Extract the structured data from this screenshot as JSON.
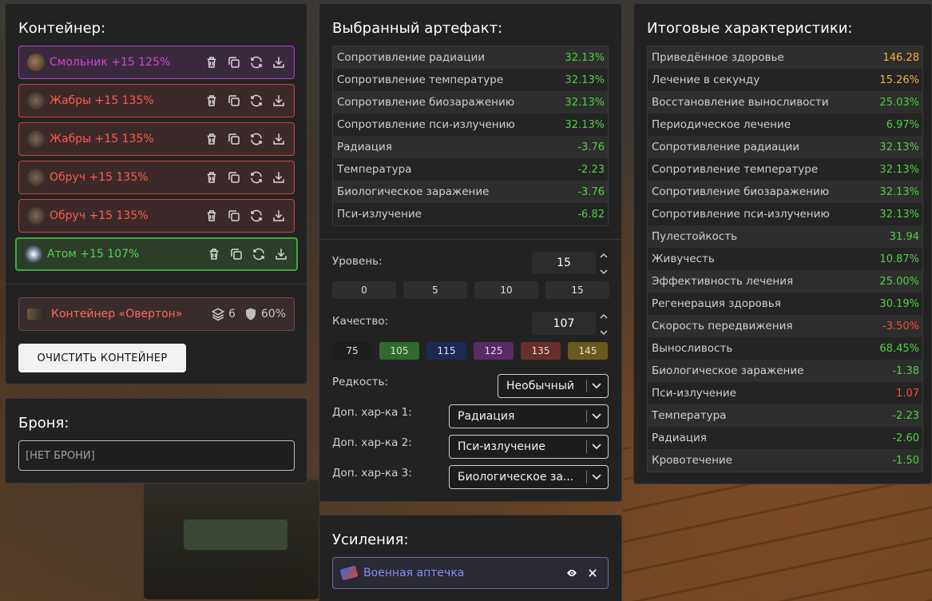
{
  "container": {
    "title": "Контейнер:",
    "items": [
      {
        "label": "Смольник +15 125%",
        "color": "purple",
        "icon": "smolnik-artifact-icon"
      },
      {
        "label": "Жабры +15 135%",
        "color": "red",
        "icon": "gills-artifact-icon"
      },
      {
        "label": "Жабры +15 135%",
        "color": "red",
        "icon": "gills-artifact-icon"
      },
      {
        "label": "Обруч +15 135%",
        "color": "red",
        "icon": "hoop-artifact-icon"
      },
      {
        "label": "Обруч +15 135%",
        "color": "red",
        "icon": "hoop-artifact-icon"
      },
      {
        "label": "Атом +15 107%",
        "color": "green",
        "icon": "atom-artifact-icon"
      }
    ],
    "container_type": {
      "label": "Контейнер «Овертон»",
      "slots": "6",
      "protection": "60%"
    },
    "clear_label": "ОЧИСТИТЬ КОНТЕЙНЕР"
  },
  "armor": {
    "title": "Броня:",
    "value": "[НЕТ БРОНИ]"
  },
  "artifact": {
    "title": "Выбранный артефакт:",
    "stats": [
      {
        "name": "Сопротивление радиации",
        "value": "32.13%",
        "tone": "pos"
      },
      {
        "name": "Сопротивление температуре",
        "value": "32.13%",
        "tone": "pos"
      },
      {
        "name": "Сопротивление биозаражению",
        "value": "32.13%",
        "tone": "pos"
      },
      {
        "name": "Сопротивление пси-излучению",
        "value": "32.13%",
        "tone": "pos"
      },
      {
        "name": "Радиация",
        "value": "-3.76",
        "tone": "pos"
      },
      {
        "name": "Температура",
        "value": "-2.23",
        "tone": "pos"
      },
      {
        "name": "Биологическое заражение",
        "value": "-3.76",
        "tone": "pos"
      },
      {
        "name": "Пси-излучение",
        "value": "-6.82",
        "tone": "pos"
      }
    ],
    "level_label": "Уровень:",
    "level_value": "15",
    "level_presets": [
      "0",
      "5",
      "10",
      "15"
    ],
    "quality_label": "Качество:",
    "quality_value": "107",
    "quality_presets": [
      {
        "label": "75",
        "color": "#1e1e1e"
      },
      {
        "label": "105",
        "color": "#2f6a2c"
      },
      {
        "label": "115",
        "color": "#1e2a55"
      },
      {
        "label": "125",
        "color": "#5a2a66"
      },
      {
        "label": "135",
        "color": "#6a2e2a"
      },
      {
        "label": "145",
        "color": "#6a5a1e"
      }
    ],
    "rarity_label": "Редкость:",
    "rarity_value": "Необычный",
    "extra1_label": "Доп. хар-ка 1:",
    "extra1_value": "Радиация",
    "extra2_label": "Доп. хар-ка 2:",
    "extra2_value": "Пси-излучение",
    "extra3_label": "Доп. хар-ка 3:",
    "extra3_value": "Биологическое за..."
  },
  "boosts": {
    "title": "Усиления:",
    "item_label": "Военная аптечка"
  },
  "totals": {
    "title": "Итоговые характеристики:",
    "stats": [
      {
        "name": "Приведённое здоровье",
        "value": "146.28",
        "tone": "orange"
      },
      {
        "name": "Лечение в секунду",
        "value": "15.26%",
        "tone": "orange"
      },
      {
        "name": "Восстановление выносливости",
        "value": "25.03%",
        "tone": "pos"
      },
      {
        "name": "Периодическое лечение",
        "value": "6.97%",
        "tone": "pos"
      },
      {
        "name": "Сопротивление радиации",
        "value": "32.13%",
        "tone": "pos"
      },
      {
        "name": "Сопротивление температуре",
        "value": "32.13%",
        "tone": "pos"
      },
      {
        "name": "Сопротивление биозаражению",
        "value": "32.13%",
        "tone": "pos"
      },
      {
        "name": "Сопротивление пси-излучению",
        "value": "32.13%",
        "tone": "pos"
      },
      {
        "name": "Пулестойкость",
        "value": "31.94",
        "tone": "pos"
      },
      {
        "name": "Живучесть",
        "value": "10.87%",
        "tone": "pos"
      },
      {
        "name": "Эффективность лечения",
        "value": "25.00%",
        "tone": "pos"
      },
      {
        "name": "Регенерация здоровья",
        "value": "30.19%",
        "tone": "pos"
      },
      {
        "name": "Скорость передвижения",
        "value": "-3.50%",
        "tone": "red"
      },
      {
        "name": "Выносливость",
        "value": "68.45%",
        "tone": "pos"
      },
      {
        "name": "Биологическое заражение",
        "value": "-1.38",
        "tone": "pos"
      },
      {
        "name": "Пси-излучение",
        "value": "1.07",
        "tone": "red"
      },
      {
        "name": "Температура",
        "value": "-2.23",
        "tone": "pos"
      },
      {
        "name": "Радиация",
        "value": "-2.60",
        "tone": "pos"
      },
      {
        "name": "Кровотечение",
        "value": "-1.50",
        "tone": "pos"
      }
    ]
  }
}
